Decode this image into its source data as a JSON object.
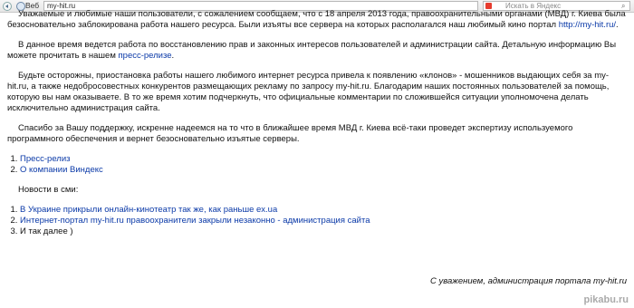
{
  "browser": {
    "tab_label": "Веб",
    "url": "my-hit.ru",
    "search_placeholder": "Искать в Яндекс"
  },
  "paragraphs": {
    "p1_text": "Уважаемые и любимые наши пользователи, с сожалением сообщаем, что с 18 апреля 2013 года, правоохранительными органами (МВД) г. Киева была безосновательно заблокирована работа нашего ресурса. Были изъяты все сервера на которых располагался наш любимый кино портал ",
    "p1_link": "http://my-hit.ru/",
    "p1_end": ".",
    "p2_text": "В данное время ведется работа по восстановлению прав и законных интересов пользователей и администрации сайта. Детальную информацию Вы можете прочитать в нашем ",
    "p2_link": "пресс-релизе",
    "p2_end": ".",
    "p3_text": "Будьте осторожны, приостановка работы нашего любимого интернет ресурса привела к появлению «клонов» - мошенников выдающих себя за my-hit.ru, а также недобросовестных конкурентов размещающих рекламу по запросу my-hit.ru. Благодарим наших постоянных пользователей за помощь, которую вы нам оказываете. В то же время хотим подчеркнуть, что официальные комментарии по сложившейся ситуации уполномочена делать исключительно администрация сайта.",
    "p4_text": "Спасибо за Вашу поддержку, искренне надеемся на то что в ближайшее время МВД г. Киева всё-таки проведет экспертизу используемого программного обеспечения и вернет безосновательно изъятые серверы."
  },
  "links_list": [
    "Пресс-релиз",
    "О компании Виндекс"
  ],
  "news_heading": "Новости в сми:",
  "news_list": [
    "В Украине прикрыли онлайн-кинотеатр так же, как раньше ex.ua",
    "Интернет-портал my-hit.ru правоохранители закрыли незаконно - администрация сайта",
    "И так далее )"
  ],
  "signoff": "С уважением, администрация портала my-hit.ru",
  "watermark": "pikabu.ru"
}
